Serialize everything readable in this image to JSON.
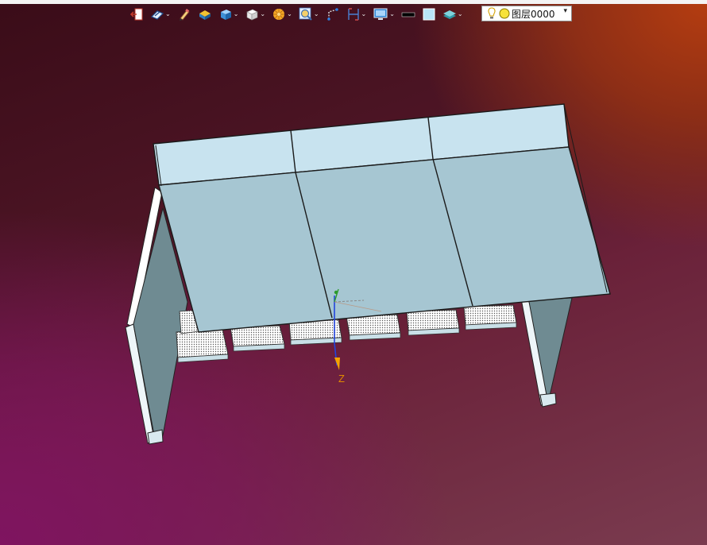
{
  "toolbar": {
    "tools": [
      {
        "name": "exit-icon",
        "caret": false
      },
      {
        "name": "sketch-mode-icon",
        "caret": true
      },
      {
        "name": "pencil-icon",
        "caret": false
      },
      {
        "name": "solid-icon",
        "caret": false
      },
      {
        "name": "box-view-icon",
        "caret": true
      },
      {
        "name": "cube-icon",
        "caret": true
      },
      {
        "name": "color-wheel-icon",
        "caret": true
      },
      {
        "name": "zoom-icon",
        "caret": true
      },
      {
        "name": "axis-icon",
        "caret": false
      },
      {
        "name": "dimension-icon",
        "caret": true
      },
      {
        "name": "display-icon",
        "caret": true
      },
      {
        "name": "line-color-swatch",
        "caret": false
      },
      {
        "name": "fill-color-swatch",
        "caret": false
      },
      {
        "name": "layer-stack-icon",
        "caret": true
      }
    ],
    "caret_glyph": "⌄",
    "layer": {
      "name": "图层0000",
      "dropdown_glyph": "▾"
    }
  },
  "viewport": {
    "axis_label": "Z",
    "model_color": "#a7c6d3",
    "accent": "#e08a00"
  }
}
